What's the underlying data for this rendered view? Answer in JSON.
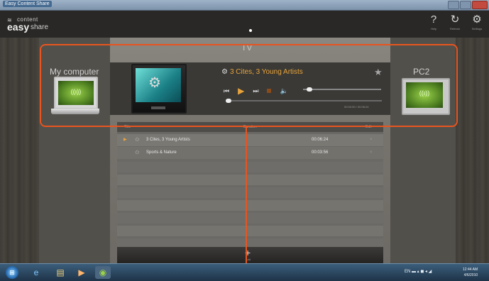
{
  "window": {
    "title": "Easy Content Share"
  },
  "app": {
    "logo_wifi": "≋",
    "logo_content": "content",
    "logo_easy": "easy",
    "logo_share": "share",
    "header_buttons": [
      {
        "icon": "help-icon",
        "glyph": "?",
        "caption": "Help"
      },
      {
        "icon": "refresh-icon",
        "glyph": "↻",
        "caption": "Refresh"
      },
      {
        "icon": "settings-icon",
        "glyph": "⚙",
        "caption": "Settings"
      }
    ]
  },
  "devices": {
    "left_label": "My computer",
    "center_label": "TV",
    "right_label": "PC2",
    "signal": "((ı))"
  },
  "player": {
    "now_playing": "3 Cites, 3 Young Artists",
    "film_icon": "⚙",
    "star": "★",
    "time": "00:00:00 / 00:06:24",
    "volume_level": 0.05,
    "progress": 0.0,
    "controls": {
      "prev": "⏮",
      "play": "▶",
      "next": "⏭",
      "mute": "🔈"
    }
  },
  "playlist": {
    "headers": {
      "title": "Title",
      "duration": "Duration",
      "edit": "Edit"
    },
    "rows": [
      {
        "playing": "▶",
        "star": "✩",
        "title": "3 Cites, 3 Young Artists",
        "duration": "00:06:24",
        "remove": "×"
      },
      {
        "playing": "",
        "star": "✩",
        "title": "Sports & Nature",
        "duration": "00:03:56",
        "remove": "×"
      }
    ],
    "add_glyph": "+",
    "add_caption": "Add"
  },
  "taskbar": {
    "start_glyph": "⊞",
    "apps": [
      {
        "icon": "ie-icon",
        "glyph": "e"
      },
      {
        "icon": "explorer-icon",
        "glyph": "▤"
      },
      {
        "icon": "media-player-icon",
        "glyph": "▶"
      },
      {
        "icon": "easy-share-icon",
        "glyph": "◉"
      }
    ],
    "tray": "EN ▬ ▴ ◼ ◂ ◢",
    "time": "12:44 AM",
    "date": "4/6/2010"
  },
  "colors": {
    "accent": "#e9a33a",
    "highlight": "#e8541f"
  }
}
